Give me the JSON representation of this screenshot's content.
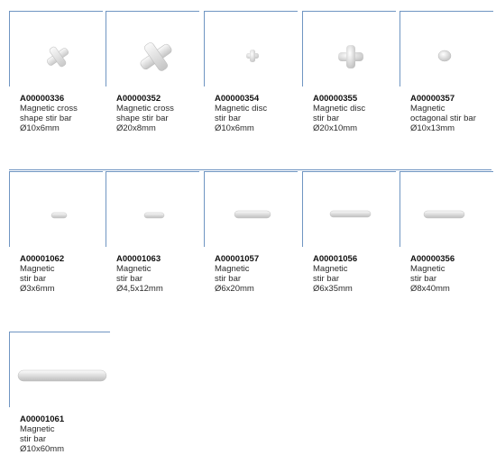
{
  "products": [
    {
      "code": "A00000336",
      "lines": [
        "Magnetic cross",
        "shape stir bar",
        "Ø10x6mm"
      ],
      "icon": "cross-small-icon"
    },
    {
      "code": "A00000352",
      "lines": [
        "Magnetic cross",
        "shape stir bar",
        "Ø20x8mm"
      ],
      "icon": "cross-large-icon"
    },
    {
      "code": "A00000354",
      "lines": [
        "Magnetic disc",
        "stir bar",
        "Ø10x6mm"
      ],
      "icon": "disc-small-icon"
    },
    {
      "code": "A00000355",
      "lines": [
        "Magnetic disc",
        "stir bar",
        "Ø20x10mm"
      ],
      "icon": "disc-large-icon"
    },
    {
      "code": "A00000357",
      "lines": [
        "Magnetic",
        "octagonal stir bar",
        "Ø10x13mm"
      ],
      "icon": "octagonal-icon"
    },
    {
      "code": "A00001062",
      "lines": [
        "Magnetic",
        "stir bar",
        "Ø3x6mm"
      ],
      "icon": "stir-bar-3x6-icon"
    },
    {
      "code": "A00001063",
      "lines": [
        "Magnetic",
        "stir bar",
        "Ø4,5x12mm"
      ],
      "icon": "stir-bar-4-5x12-icon"
    },
    {
      "code": "A00001057",
      "lines": [
        "Magnetic",
        "stir bar",
        "Ø6x20mm"
      ],
      "icon": "stir-bar-6x20-icon"
    },
    {
      "code": "A00001056",
      "lines": [
        "Magnetic",
        "stir bar",
        "Ø6x35mm"
      ],
      "icon": "stir-bar-6x35-icon"
    },
    {
      "code": "A00000356",
      "lines": [
        "Magnetic",
        "stir bar",
        "Ø8x40mm"
      ],
      "icon": "stir-bar-8x40-icon"
    },
    {
      "code": "A00001061",
      "lines": [
        "Magnetic",
        "stir bar",
        "Ø10x60mm"
      ],
      "icon": "stir-bar-10x60-icon"
    }
  ]
}
